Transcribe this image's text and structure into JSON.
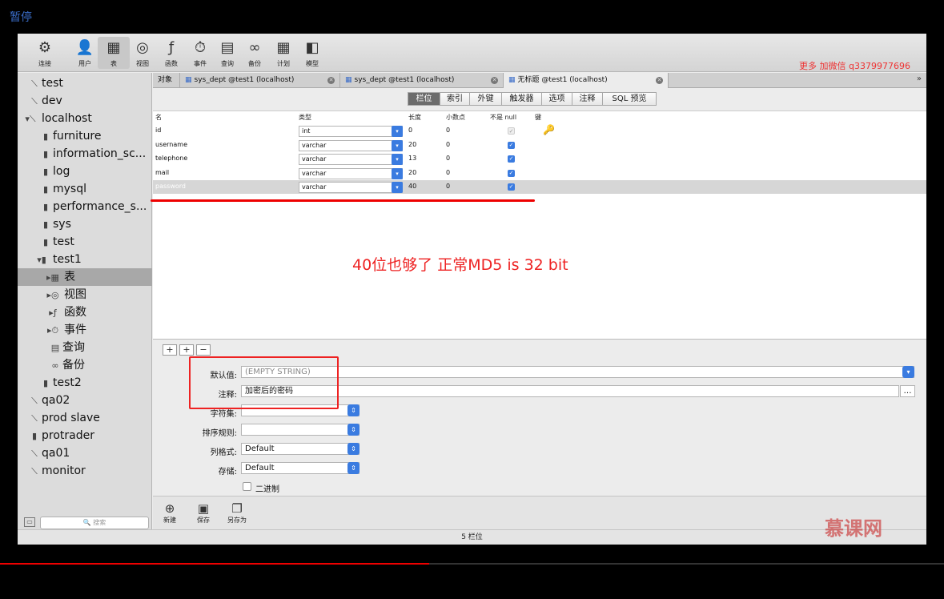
{
  "video": {
    "pause_label": "暂停",
    "progress": 0.455
  },
  "watermark": {
    "top": "更多 加微信 q3379977696",
    "logo": "慕课网"
  },
  "toolbar": {
    "items": [
      {
        "label": "连接",
        "icon": "connect-icon",
        "glyph": "⚙"
      },
      {
        "label": "用户",
        "icon": "user-icon",
        "glyph": "👤"
      },
      {
        "label": "表",
        "icon": "table-icon",
        "glyph": "▦"
      },
      {
        "label": "视图",
        "icon": "view-icon",
        "glyph": "◎"
      },
      {
        "label": "函数",
        "icon": "function-icon",
        "glyph": "ƒ"
      },
      {
        "label": "事件",
        "icon": "event-icon",
        "glyph": "⏱"
      },
      {
        "label": "查询",
        "icon": "query-icon",
        "glyph": "▤"
      },
      {
        "label": "备份",
        "icon": "backup-icon",
        "glyph": "∞"
      },
      {
        "label": "计划",
        "icon": "schedule-icon",
        "glyph": "▦"
      },
      {
        "label": "模型",
        "icon": "model-icon",
        "glyph": "◧"
      }
    ]
  },
  "sidebar": {
    "items": [
      {
        "label": "test",
        "icon": "connection-icon",
        "glyph": "⟍"
      },
      {
        "label": "dev",
        "icon": "connection-icon",
        "glyph": "⟍"
      },
      {
        "label": "localhost",
        "icon": "connection-icon",
        "glyph": "▾⟍"
      },
      {
        "label": "furniture",
        "icon": "database-icon",
        "glyph": "▮"
      },
      {
        "label": "information_sc...",
        "icon": "database-icon",
        "glyph": "▮"
      },
      {
        "label": "log",
        "icon": "database-icon",
        "glyph": "▮"
      },
      {
        "label": "mysql",
        "icon": "database-icon",
        "glyph": "▮"
      },
      {
        "label": "performance_s...",
        "icon": "database-icon",
        "glyph": "▮"
      },
      {
        "label": "sys",
        "icon": "database-icon",
        "glyph": "▮"
      },
      {
        "label": "test",
        "icon": "database-icon",
        "glyph": "▮"
      },
      {
        "label": "test1",
        "icon": "database-icon",
        "glyph": "▾▮"
      },
      {
        "label": "表",
        "icon": "table-icon",
        "glyph": "▸▦"
      },
      {
        "label": "视图",
        "icon": "view-icon",
        "glyph": "▸◎"
      },
      {
        "label": "函数",
        "icon": "function-icon",
        "glyph": "▸ƒ"
      },
      {
        "label": "事件",
        "icon": "event-icon",
        "glyph": "▸⏱"
      },
      {
        "label": "查询",
        "icon": "query-icon",
        "glyph": "▤"
      },
      {
        "label": "备份",
        "icon": "backup-icon",
        "glyph": "∞"
      },
      {
        "label": "test2",
        "icon": "database-icon",
        "glyph": "▮"
      },
      {
        "label": "qa02",
        "icon": "connection-icon",
        "glyph": "⟍"
      },
      {
        "label": "prod slave",
        "icon": "connection-icon",
        "glyph": "⟍"
      },
      {
        "label": "protrader",
        "icon": "connection-icon",
        "glyph": "▮"
      },
      {
        "label": "qa01",
        "icon": "connection-icon",
        "glyph": "⟍"
      },
      {
        "label": "monitor",
        "icon": "connection-icon",
        "glyph": "⟍"
      }
    ],
    "search_placeholder": "🔍 搜索"
  },
  "tabs": [
    {
      "label": "对象"
    },
    {
      "label": "sys_dept @test1 (localhost)"
    },
    {
      "label": "sys_dept @test1 (localhost)"
    },
    {
      "label": "无标题 @test1 (localhost)"
    }
  ],
  "subtabs": [
    "栏位",
    "索引",
    "外键",
    "触发器",
    "选项",
    "注释",
    "SQL 预览"
  ],
  "grid": {
    "headers": [
      "名",
      "类型",
      "长度",
      "小数点",
      "不是 null",
      "键"
    ],
    "rows": [
      {
        "name": "id",
        "type": "int",
        "length": "0",
        "decimals": "0",
        "not_null": "✓",
        "key": "🔑"
      },
      {
        "name": "username",
        "type": "varchar",
        "length": "20",
        "decimals": "0",
        "not_null": "✓",
        "key": ""
      },
      {
        "name": "telephone",
        "type": "varchar",
        "length": "13",
        "decimals": "0",
        "not_null": "✓",
        "key": ""
      },
      {
        "name": "mail",
        "type": "varchar",
        "length": "20",
        "decimals": "0",
        "not_null": "✓",
        "key": ""
      },
      {
        "name": "password",
        "type": "varchar",
        "length": "40",
        "decimals": "0",
        "not_null": "✓",
        "key": ""
      }
    ]
  },
  "annotation": "40位也够了   正常MD5   is  32 bit",
  "field_props": {
    "default_label": "默认值:",
    "default_value": "(EMPTY STRING)",
    "comment_label": "注释:",
    "comment_value": "加密后的密码",
    "charset_label": "字符集:",
    "collation_label": "排序规则:",
    "format_label": "列格式:",
    "format_value": "Default",
    "storage_label": "存储:",
    "storage_value": "Default",
    "binary_label": "二进制"
  },
  "bottom_toolbar": [
    {
      "label": "新建",
      "icon": "new-icon",
      "glyph": "⊕"
    },
    {
      "label": "保存",
      "icon": "save-icon",
      "glyph": "▣"
    },
    {
      "label": "另存为",
      "icon": "save-as-icon",
      "glyph": "❐"
    }
  ],
  "status": "5 栏位"
}
